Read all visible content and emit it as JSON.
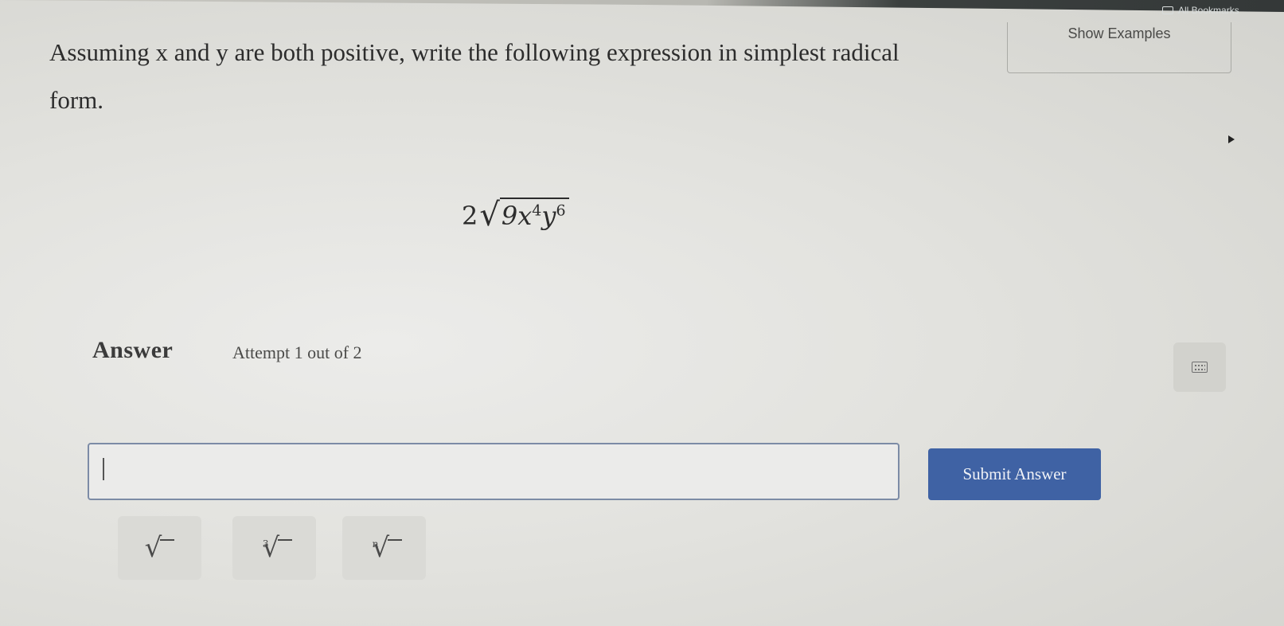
{
  "browser": {
    "bookmarks_label": "All Bookmarks"
  },
  "examples_button": {
    "label": "Show Examples"
  },
  "question": {
    "line1": "Assuming x and y are both positive, write the following expression in simplest radical",
    "line2": "form."
  },
  "expression": {
    "coefficient": "2",
    "radical_symbol": "√",
    "radicand_base": "9x",
    "x_exponent": "4",
    "y_var": "y",
    "y_exponent": "6"
  },
  "answer": {
    "label": "Answer",
    "attempt_text": "Attempt 1 out of 2",
    "input_value": "",
    "submit_label": "Submit Answer"
  },
  "radical_buttons": {
    "square_symbol": "√",
    "cube_index": "3",
    "nth_index": "n"
  },
  "icons": [
    "folder-icon",
    "keyboard-icon",
    "cursor-arrow-icon"
  ],
  "colors": {
    "submit_button": "#3f62a4",
    "input_border": "#7c8ba6"
  }
}
